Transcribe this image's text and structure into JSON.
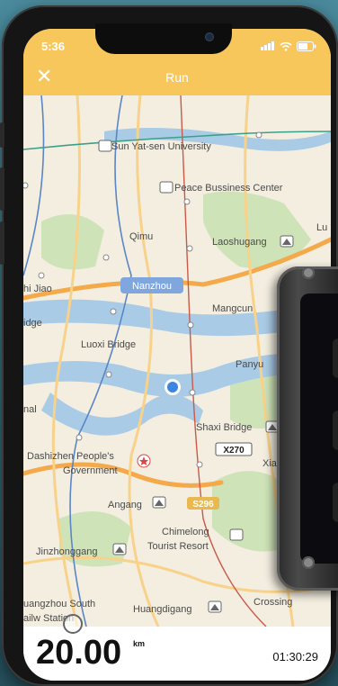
{
  "status": {
    "time": "5:36"
  },
  "header": {
    "title": "Run",
    "close_icon": "close-icon"
  },
  "map": {
    "labels": {
      "sun_yat_sen": "Sun Yat-sen University",
      "peace_center": "Peace Bussiness Center",
      "qimu": "Qimu",
      "laoshugang": "Laoshugang",
      "lu": "Lu",
      "nanzhou": "Nanzhou",
      "hi_jiao": "hi Jiao",
      "idge": "idge",
      "mangcun": "Mangcun",
      "luoxi_bridge": "Luoxi Bridge",
      "panyu": "Panyu",
      "nal": "nal",
      "shaxi_bridge": "Shaxi Bridge",
      "x270": "X270",
      "xia": "Xia",
      "dashizhen_1": "Dashizhen People's",
      "dashizhen_2": "Government",
      "angang": "Angang",
      "s296": "S296",
      "chimelong_1": "Chimelong",
      "chimelong_2": "Tourist Resort",
      "jinzhonggang": "Jinzhonggang",
      "crossing": "Crossing",
      "guangzhou_south_1": "uangzhou South",
      "guangzhou_south_2": "ailw   Station",
      "huangdigang": "Huangdigang"
    }
  },
  "stats": {
    "distance": "20.00",
    "unit": "km",
    "duration": "01:30:29"
  },
  "colors": {
    "header": "#f7c75b",
    "water": "#aacbe6",
    "park": "#cfe3b8",
    "location": "#3a86e0"
  }
}
